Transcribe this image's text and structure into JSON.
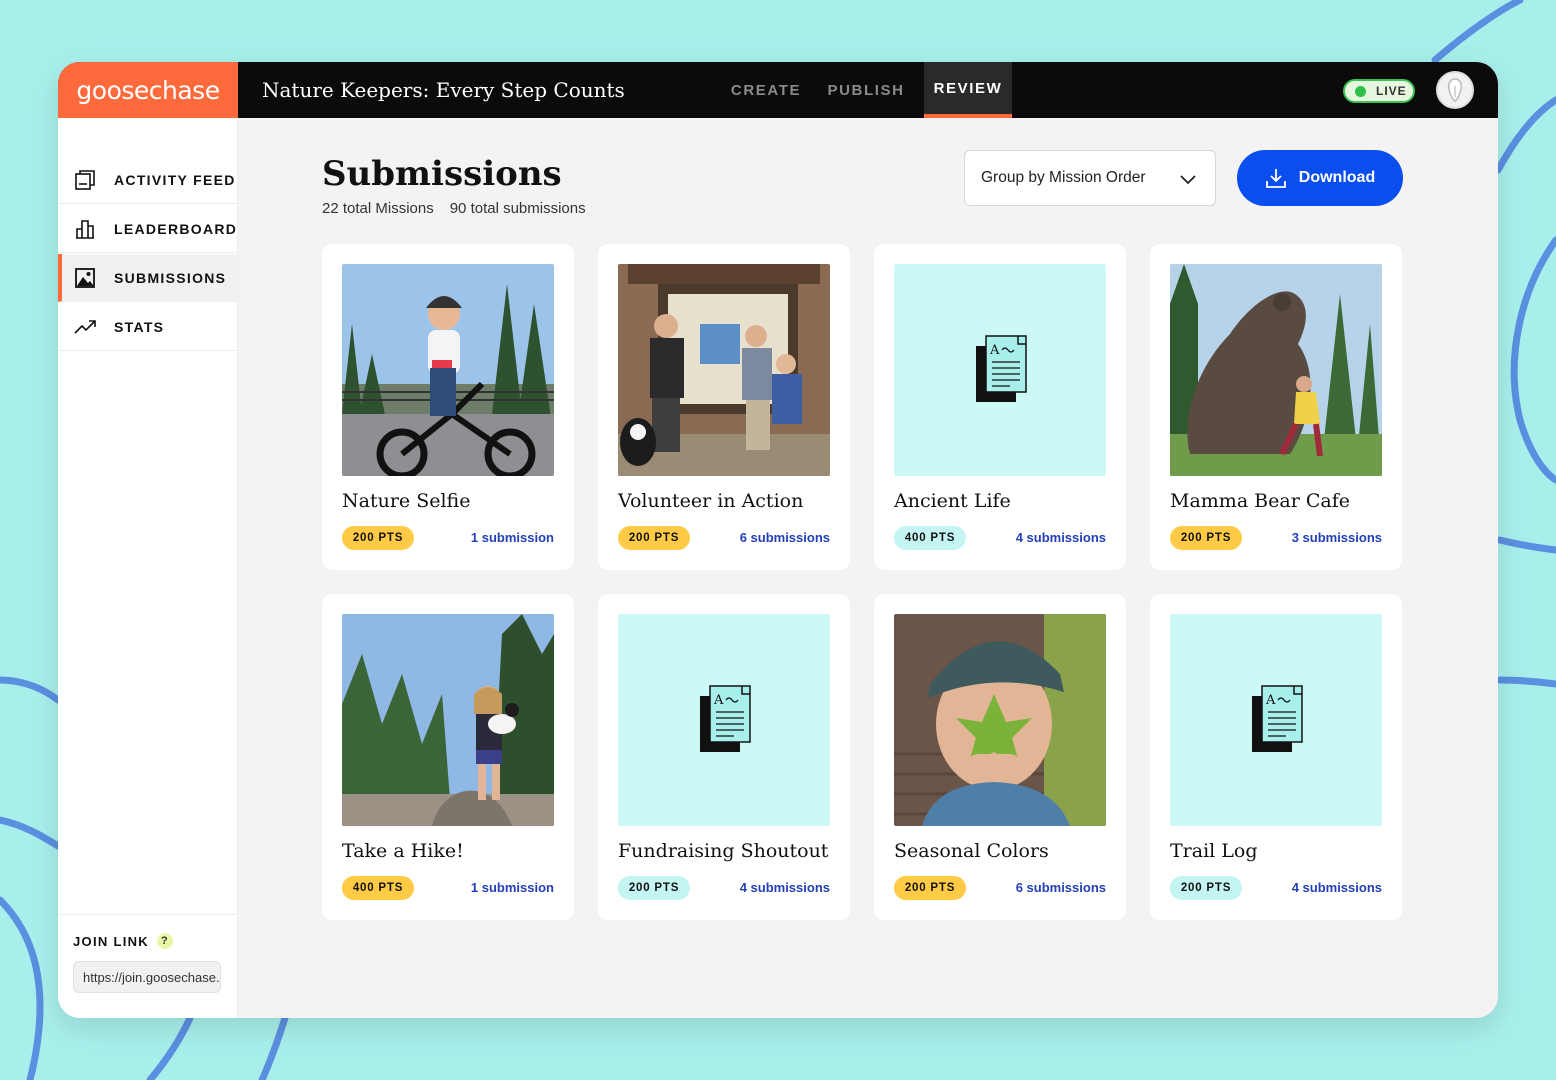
{
  "app": {
    "logo": "goosechase",
    "game_title": "Nature Keepers: Every Step Counts",
    "tabs": [
      {
        "label": "CREATE"
      },
      {
        "label": "PUBLISH"
      },
      {
        "label": "REVIEW",
        "active": true
      }
    ],
    "status_label": "LIVE",
    "accent_color": "#ff6a3d",
    "primary_color": "#0a4ef0"
  },
  "sidebar": {
    "items": [
      {
        "label": "ACTIVITY FEED",
        "icon": "feed-icon"
      },
      {
        "label": "LEADERBOARD",
        "icon": "bar-chart-icon"
      },
      {
        "label": "SUBMISSIONS",
        "icon": "image-icon",
        "active": true
      },
      {
        "label": "STATS",
        "icon": "trend-icon"
      }
    ],
    "join_label": "JOIN LINK",
    "join_help": "?",
    "join_url": "https://join.goosechase.app"
  },
  "main": {
    "title": "Submissions",
    "total_missions": "22 total Missions",
    "total_submissions": "90 total submissions",
    "group_select": "Group by Mission Order",
    "download_label": "Download"
  },
  "missions": [
    {
      "title": "Nature Selfie",
      "points": "200 PTS",
      "submissions": "1 submission",
      "badge": "yellow",
      "media": "photo"
    },
    {
      "title": "Volunteer in Action",
      "points": "200 PTS",
      "submissions": "6 submissions",
      "badge": "yellow",
      "media": "photo"
    },
    {
      "title": "Ancient Life",
      "points": "400 PTS",
      "submissions": "4 submissions",
      "badge": "teal",
      "media": "document-icon"
    },
    {
      "title": "Mamma Bear Cafe",
      "points": "200 PTS",
      "submissions": "3 submissions",
      "badge": "yellow",
      "media": "photo"
    },
    {
      "title": "Take a Hike!",
      "points": "400 PTS",
      "submissions": "1 submission",
      "badge": "yellow",
      "media": "photo"
    },
    {
      "title": "Fundraising Shoutout",
      "points": "200 PTS",
      "submissions": "4 submissions",
      "badge": "teal",
      "media": "document-icon"
    },
    {
      "title": "Seasonal Colors",
      "points": "200 PTS",
      "submissions": "6 submissions",
      "badge": "yellow",
      "media": "photo"
    },
    {
      "title": "Trail Log",
      "points": "200 PTS",
      "submissions": "4 submissions",
      "badge": "teal",
      "media": "document-icon"
    }
  ]
}
